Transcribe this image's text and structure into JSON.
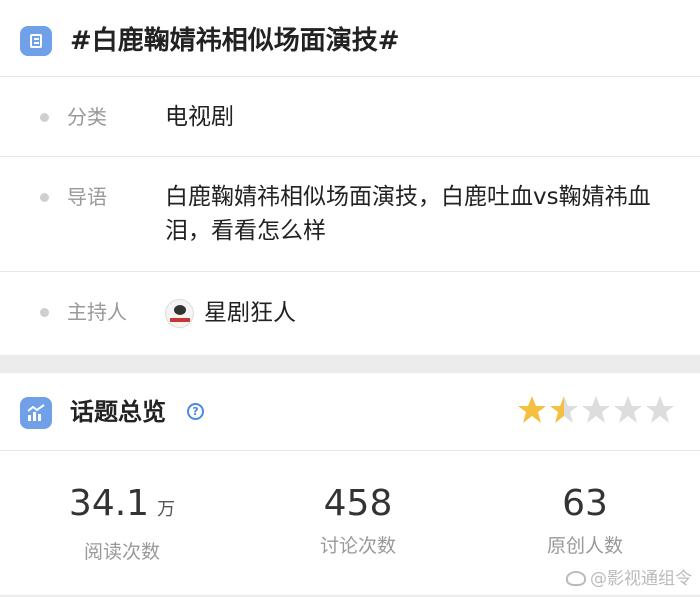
{
  "topic": {
    "title": "#白鹿鞠婧祎相似场面演技#",
    "icon": "document-list-icon"
  },
  "info": {
    "category_label": "分类",
    "category_value": "电视剧",
    "guide_label": "导语",
    "guide_value": "白鹿鞠婧祎相似场面演技，白鹿吐血vs鞠婧祎血泪，看看怎么样",
    "host_label": "主持人",
    "host_name": "星剧狂人",
    "host_avatar": "avatar"
  },
  "overview": {
    "title": "话题总览",
    "help_icon": "question-circle-icon",
    "chart_icon": "trend-chart-icon",
    "rating_value": 1.5,
    "rating_max": 5,
    "star_color": "#f5c042",
    "star_empty_color": "#dddddd"
  },
  "stats": [
    {
      "value": "34.1",
      "unit": "万",
      "label": "阅读次数"
    },
    {
      "value": "458",
      "unit": "",
      "label": "讨论次数"
    },
    {
      "value": "63",
      "unit": "",
      "label": "原创人数"
    }
  ],
  "watermark": {
    "text": "@影视通组令",
    "icon": "weibo-icon"
  },
  "colors": {
    "accent": "#6fa0e8",
    "help": "#4a8ae0"
  }
}
